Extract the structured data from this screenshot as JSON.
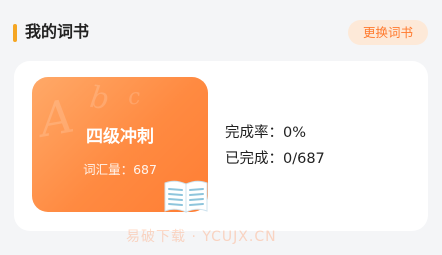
{
  "header": {
    "title": "我的词书",
    "change_button": "更换词书",
    "accent_color": "#f5a623"
  },
  "book": {
    "name": "四级冲刺",
    "vocab_count": "词汇量：687",
    "cover_decoration": "A b c",
    "cover_color": "#ff8a41"
  },
  "stats": {
    "completion_rate": "完成率：0%",
    "completed": "已完成：0/687"
  },
  "watermark": "易破下载 · YCUJX.CN"
}
